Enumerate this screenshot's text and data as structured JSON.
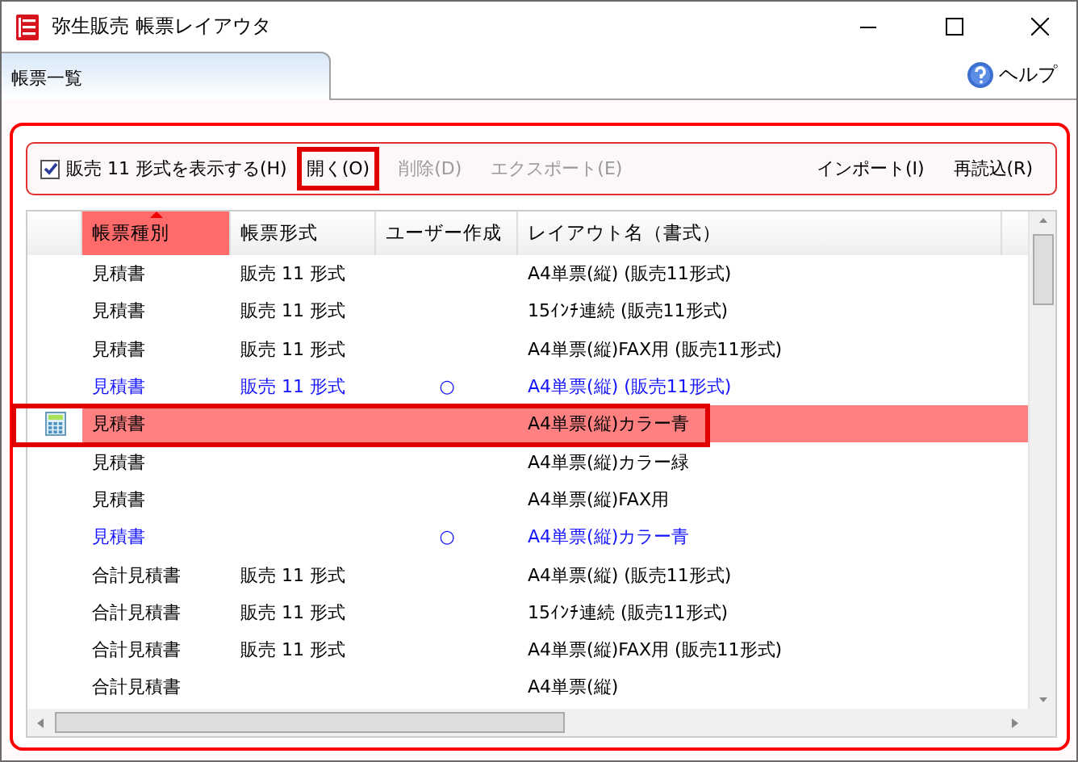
{
  "window": {
    "title": "弥生販売 帳票レイアウタ"
  },
  "tabs": [
    {
      "label": "帳票一覧",
      "selected": true
    }
  ],
  "help": {
    "label": "ヘルプ"
  },
  "toolbar": {
    "checkbox": {
      "label": "販売 11 形式を表示する(H)",
      "checked": true
    },
    "buttons": [
      {
        "label": "開く(O)",
        "disabled": false,
        "marked": true
      },
      {
        "label": "削除(D)",
        "disabled": true,
        "marked": false
      },
      {
        "label": "エクスポート(E)",
        "disabled": true,
        "marked": false
      },
      {
        "label": "インポート(I)",
        "disabled": false,
        "marked": false
      },
      {
        "label": "再読込(R)",
        "disabled": false,
        "marked": false
      }
    ]
  },
  "table": {
    "columns": [
      {
        "label": "帳票種別",
        "sorted": true
      },
      {
        "label": "帳票形式",
        "sorted": false
      },
      {
        "label": "ユーザー作成",
        "sorted": false
      },
      {
        "label": "レイアウト名（書式）",
        "sorted": false
      }
    ],
    "rows": [
      {
        "type": "見積書",
        "format": "販売 11 形式",
        "user_created": "",
        "layout": "A4単票(縦) (販売11形式)",
        "user": false,
        "selected": false
      },
      {
        "type": "見積書",
        "format": "販売 11 形式",
        "user_created": "",
        "layout": "15ｲﾝﾁ連続 (販売11形式)",
        "user": false,
        "selected": false
      },
      {
        "type": "見積書",
        "format": "販売 11 形式",
        "user_created": "",
        "layout": "A4単票(縦)FAX用 (販売11形式)",
        "user": false,
        "selected": false
      },
      {
        "type": "見積書",
        "format": "販売 11 形式",
        "user_created": "○",
        "layout": "A4単票(縦) (販売11形式)",
        "user": true,
        "selected": false
      },
      {
        "type": "見積書",
        "format": "",
        "user_created": "",
        "layout": "A4単票(縦)カラー青",
        "user": false,
        "selected": true
      },
      {
        "type": "見積書",
        "format": "",
        "user_created": "",
        "layout": "A4単票(縦)カラー緑",
        "user": false,
        "selected": false
      },
      {
        "type": "見積書",
        "format": "",
        "user_created": "",
        "layout": "A4単票(縦)FAX用",
        "user": false,
        "selected": false
      },
      {
        "type": "見積書",
        "format": "",
        "user_created": "○",
        "layout": "A4単票(縦)カラー青",
        "user": true,
        "selected": false
      },
      {
        "type": "合計見積書",
        "format": "販売 11 形式",
        "user_created": "",
        "layout": "A4単票(縦) (販売11形式)",
        "user": false,
        "selected": false
      },
      {
        "type": "合計見積書",
        "format": "販売 11 形式",
        "user_created": "",
        "layout": "15ｲﾝﾁ連続 (販売11形式)",
        "user": false,
        "selected": false
      },
      {
        "type": "合計見積書",
        "format": "販売 11 形式",
        "user_created": "",
        "layout": "A4単票(縦)FAX用 (販売11形式)",
        "user": false,
        "selected": false
      },
      {
        "type": "合計見積書",
        "format": "",
        "user_created": "",
        "layout": "A4単票(縦)",
        "user": false,
        "selected": false
      }
    ]
  }
}
